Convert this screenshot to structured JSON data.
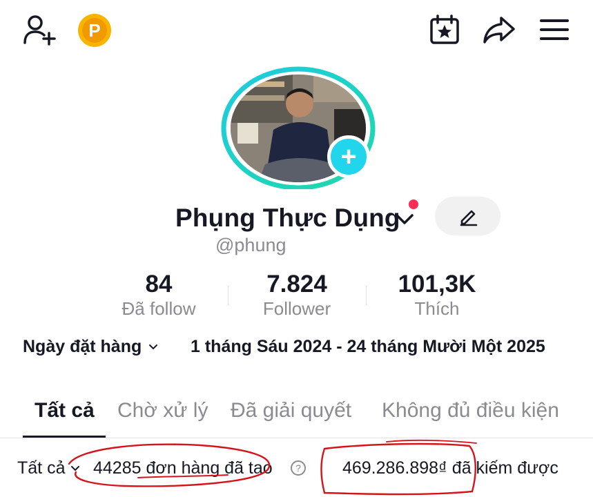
{
  "header": {
    "add_user_icon": "add-user-icon",
    "coin_icon": "coin-icon",
    "coin_letter": "P",
    "calendar_icon": "calendar-star-icon",
    "share_icon": "share-icon",
    "menu_icon": "hamburger-menu-icon"
  },
  "profile": {
    "display_name": "Phụng Thực Dụng",
    "username": "@phung",
    "plus_label": "+",
    "verified_chevron_icon": "chevron-down-icon",
    "edit_icon": "pencil-icon"
  },
  "stats": [
    {
      "value": "84",
      "label": "Đã follow"
    },
    {
      "value": "7.824",
      "label": "Follower"
    },
    {
      "value": "101,3K",
      "label": "Thích"
    }
  ],
  "filters": {
    "date_label": "Ngày đặt hàng",
    "date_range": "1 tháng Sáu 2024 - 24 tháng Mười Một 2025"
  },
  "tabs": [
    {
      "label": "Tất cả",
      "active": true
    },
    {
      "label": "Chờ xử lý",
      "active": false
    },
    {
      "label": "Đã giải quyết",
      "active": false
    },
    {
      "label": "Không đủ điều kiện",
      "active": false
    }
  ],
  "summary": {
    "filter_label": "Tất cả",
    "orders_text": "44285 đơn hàng đã tạo",
    "help_symbol": "?",
    "earnings_text": "469.286.898₫ đã kiếm được"
  },
  "colors": {
    "accent_red": "#fe2c55",
    "accent_cyan": "#20d5ec",
    "coin": "#f7b500",
    "annotation_red": "#d4141a"
  }
}
